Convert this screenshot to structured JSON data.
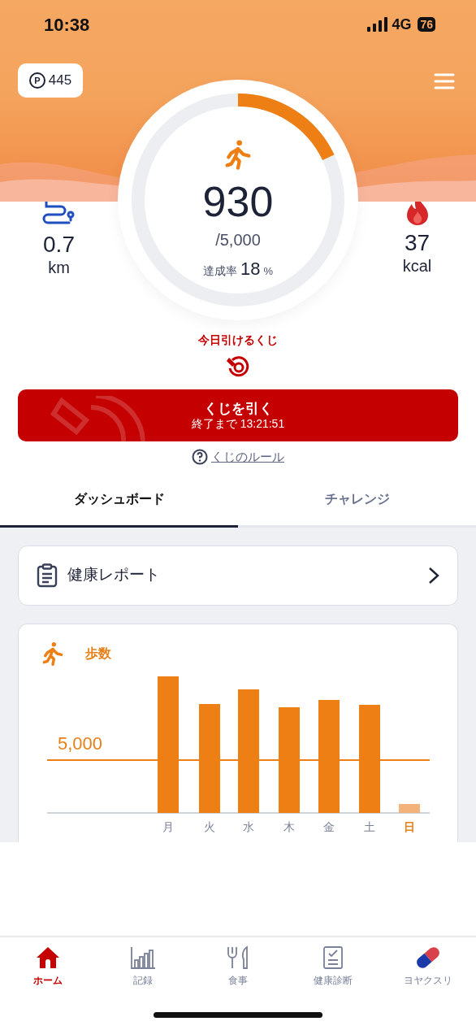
{
  "status_bar": {
    "time": "10:38",
    "network": "4G",
    "battery": "76"
  },
  "points": {
    "symbol": "P",
    "value": "445"
  },
  "steps": {
    "count": "930",
    "goal": "/5,000",
    "rate_label": "達成率",
    "rate_value": "18",
    "rate_unit": "%",
    "level": 0.18
  },
  "distance": {
    "value": "0.7",
    "unit": "km"
  },
  "calories": {
    "value": "37",
    "unit": "kcal"
  },
  "lottery": {
    "title": "今日引けるくじ",
    "button_label": "くじを引く",
    "countdown": "終了まで 13:21:51",
    "rules_link": "くじのルール"
  },
  "tabs": [
    {
      "label": "ダッシュボード",
      "selected": true
    },
    {
      "label": "チャレンジ",
      "selected": false
    }
  ],
  "report_card": {
    "label": "健康レポート"
  },
  "steps_chart": {
    "title": "歩数",
    "goal_label": "5,000",
    "days": [
      {
        "label": "月",
        "selected": false
      },
      {
        "label": "火",
        "selected": false
      },
      {
        "label": "水",
        "selected": false
      },
      {
        "label": "木",
        "selected": false
      },
      {
        "label": "金",
        "selected": false
      },
      {
        "label": "土",
        "selected": false
      },
      {
        "label": "日",
        "selected": true
      }
    ]
  },
  "bottom_nav": [
    {
      "kind": "home",
      "label": "ホーム",
      "selected": true
    },
    {
      "kind": "records",
      "label": "記録",
      "selected": false
    },
    {
      "kind": "meal",
      "label": "食事",
      "selected": false
    },
    {
      "kind": "checkup",
      "label": "健康診断",
      "selected": false
    },
    {
      "kind": "medicine",
      "label": "ヨヤクスリ",
      "selected": false
    }
  ]
}
